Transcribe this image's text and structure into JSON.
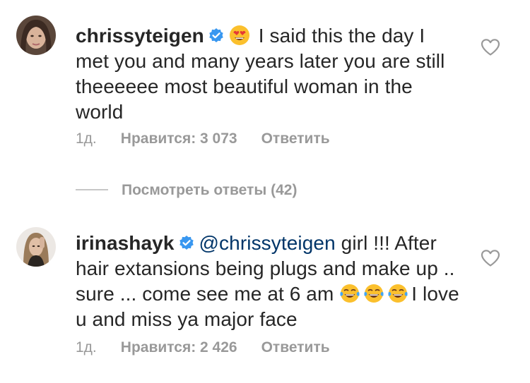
{
  "comments": [
    {
      "avatar_icon": "profile-photo-dark-hair-icon",
      "username": "chrissyteigen",
      "verified_icon": "verified-badge-icon",
      "emoji_icon": "heart-eyes-emoji-icon",
      "text": "I said this the day I met you and many years later you are still theeeeee most beautiful woman in the world",
      "time": "1д.",
      "likes": "Нравится: 3 073",
      "reply": "Ответить",
      "like_icon": "heart-outline-icon"
    },
    {
      "avatar_icon": "profile-photo-blonde-hair-icon",
      "username": "irinashayk",
      "verified_icon": "verified-badge-icon",
      "mention": "@chrissyteigen",
      "text_a": "girl !!! After hair extansions being plugs and make up .. sure ... come see me at 6 am",
      "emoji_icon": "tears-of-joy-emoji-icon",
      "text_b": "I love u and miss ya major face",
      "time": "1д.",
      "likes": "Нравится: 2 426",
      "reply": "Ответить",
      "like_icon": "heart-outline-icon"
    }
  ],
  "view_replies": {
    "label": "Посмотреть ответы (42)"
  },
  "colors": {
    "text": "#262626",
    "meta": "#999999",
    "mention": "#003569",
    "verified": "#3897f0",
    "divider": "#c7c7c7"
  }
}
